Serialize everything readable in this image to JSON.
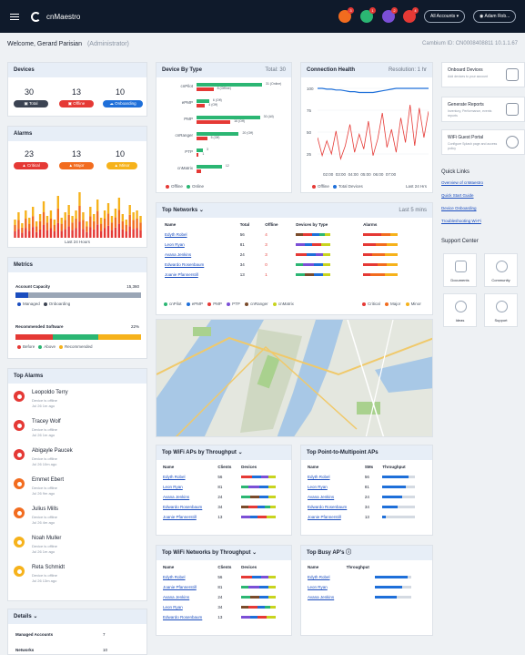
{
  "header": {
    "brand": "cnMaestro",
    "notif_counts": [
      "3",
      "1",
      "2",
      "4"
    ],
    "account_label": "All Accounts",
    "user_label": "Adam Rob..."
  },
  "welcome": {
    "text": "Welcome,  Gerard Parisian",
    "role": "(Administrator)"
  },
  "serial": {
    "text": "Cambium ID:  CN0008408811   10.1.1.67"
  },
  "devices": {
    "title": "Devices",
    "items": [
      {
        "count": "30",
        "label": "Total",
        "color": "#3b4352"
      },
      {
        "count": "13",
        "label": "Offline",
        "color": "#e53935"
      },
      {
        "count": "10",
        "label": "Onboarding",
        "color": "#1e6fd9"
      }
    ]
  },
  "alarms": {
    "title": "Alarms",
    "items": [
      {
        "count": "23",
        "label": "Critical",
        "color": "#e53935"
      },
      {
        "count": "13",
        "label": "Major",
        "color": "#f26c1f"
      },
      {
        "count": "10",
        "label": "Minor",
        "color": "#f6b21b"
      }
    ],
    "axis_label": "Last 24 Hours"
  },
  "metrics": {
    "title": "Metrics",
    "capacity_label": "Account Capacity",
    "capacity_value": "15,360",
    "capacity_fill": 0.1,
    "capacity_legend": [
      "Managed",
      "Onboarding"
    ],
    "software_label": "Recommended Software",
    "software_value": "22%",
    "software_fill": 0.22,
    "software_legend": [
      "Before",
      "Above",
      "Recommended"
    ]
  },
  "top_alarms": {
    "title": "Top Alarms",
    "items": [
      {
        "name": "Leopoldo Terry",
        "status": "Device is offline",
        "time": "Jul 26 1m ago",
        "color": "#e53935"
      },
      {
        "name": "Tracey Wolf",
        "status": "Device is offline",
        "time": "Jul 26 1m ago",
        "color": "#e53935"
      },
      {
        "name": "Abigayle Paucek",
        "status": "Device is offline",
        "time": "Jul 26 10m ago",
        "color": "#e53935"
      },
      {
        "name": "Emmet Ebert",
        "status": "Device is offline",
        "time": "Jul 26 9m ago",
        "color": "#f26c1f"
      },
      {
        "name": "Julius Mills",
        "status": "Device is offline",
        "time": "Jul 26 4m ago",
        "color": "#f26c1f"
      },
      {
        "name": "Noah Muller",
        "status": "Device is offline",
        "time": "Jul 26 1m ago",
        "color": "#f6b21b"
      },
      {
        "name": "Reta Schmidt",
        "status": "Device is offline",
        "time": "Jul 26 13m ago",
        "color": "#f6b21b"
      }
    ]
  },
  "details": {
    "title": "Details",
    "rows": [
      {
        "label": "Managed Accounts",
        "value": "7"
      },
      {
        "label": "Networks",
        "value": "10"
      }
    ]
  },
  "device_by_type": {
    "title": "Device By Type",
    "total": "Total: 30",
    "rows": [
      {
        "name": "cnPilot",
        "online": 31,
        "offline": 8,
        "online_label": "31 (Online)",
        "offline_label": "8 (Offline)"
      },
      {
        "name": "ePMP",
        "online": 6,
        "offline": 4,
        "online_label": "6 (Off)",
        "offline_label": "4 (Off)"
      },
      {
        "name": "PMP",
        "online": 30,
        "offline": 16,
        "online_label": "30 (All)",
        "offline_label": "16 (Off)"
      },
      {
        "name": "cnRanger",
        "online": 20,
        "offline": 5,
        "online_label": "20 (Off)",
        "offline_label": "5 (Off)"
      },
      {
        "name": "PTP",
        "online": 3,
        "offline": 1,
        "online_label": "3",
        "offline_label": "1"
      },
      {
        "name": "cnMatrix",
        "online": 12,
        "offline": 2,
        "online_label": "12",
        "offline_label": ""
      }
    ],
    "legend": [
      "Offline",
      "Online"
    ]
  },
  "connection_health": {
    "title": "Connection Health",
    "resolution": "Resolution: 1 hr",
    "y_ticks": [
      "100",
      "75",
      "50",
      "25"
    ],
    "x_ticks": [
      "02:00",
      "03:00",
      "04:00",
      "05:00",
      "06:00",
      "07:00"
    ],
    "x_end": "Last 24 Hrs",
    "legend": [
      "Offline",
      "Total Devices"
    ]
  },
  "top_networks": {
    "title": "Top Networks",
    "period": "Last 5 mins",
    "headers": [
      "Name",
      "Total",
      "Offline",
      "Devices by Type",
      "Alarms"
    ],
    "rows": [
      {
        "name": "Edyth Robel",
        "total": "56",
        "offline": "4"
      },
      {
        "name": "Leon Ryan",
        "total": "81",
        "offline": "3"
      },
      {
        "name": "Avana Jenkins",
        "total": "24",
        "offline": "3"
      },
      {
        "name": "Edwardo Rosenbaum",
        "total": "34",
        "offline": "0"
      },
      {
        "name": "Joanie Pfannerstill",
        "total": "13",
        "offline": "1"
      }
    ],
    "legend_types": [
      "cnPilot",
      "ePMP",
      "PMP",
      "PTP",
      "cnRanger",
      "cnMatrix"
    ],
    "legend_alarms": [
      "Critical",
      "Major",
      "Minor"
    ]
  },
  "wifi_aps": {
    "title": "Top WiFi APs by Throughput",
    "headers": [
      "Name",
      "Clients",
      "Devices"
    ],
    "rows": [
      {
        "name": "Edyth Robel",
        "clients": "56"
      },
      {
        "name": "Leon Ryan",
        "clients": "81"
      },
      {
        "name": "Avana Jenkins",
        "clients": "24"
      },
      {
        "name": "Edwardo Rosenbaum",
        "clients": "34"
      },
      {
        "name": "Joanie Pfannerstill",
        "clients": "13"
      }
    ]
  },
  "ptmp_aps": {
    "title": "Top Point-to-Multipoint APs",
    "headers": [
      "Name",
      "SMs",
      "Throughput"
    ],
    "rows": [
      {
        "name": "Edyth Robel",
        "sms": "56",
        "fill": 0.8
      },
      {
        "name": "Leon Ryan",
        "sms": "81",
        "fill": 0.7
      },
      {
        "name": "Avana Jenkins",
        "sms": "24",
        "fill": 0.6
      },
      {
        "name": "Edwardo Rosenbaum",
        "sms": "34",
        "fill": 0.45
      },
      {
        "name": "Joanie Pfannerstill",
        "sms": "13",
        "fill": 0.1
      }
    ]
  },
  "wifi_networks": {
    "title": "Top WiFi Networks by Throughput",
    "headers": [
      "Name",
      "Clients",
      "Devices"
    ],
    "rows": [
      {
        "name": "Edyth Robel",
        "clients": "56"
      },
      {
        "name": "Joanie Pfannerstill",
        "clients": "81"
      },
      {
        "name": "Avana Jenkins",
        "clients": "24"
      },
      {
        "name": "Leon Ryan",
        "clients": "34"
      },
      {
        "name": "Edwardo Rosenbaum",
        "clients": "13"
      }
    ]
  },
  "busy_aps": {
    "title": "Top Busy AP's",
    "headers": [
      "Name",
      "Throughput"
    ],
    "rows": [
      {
        "name": "Edyth Robel",
        "fill": 0.9
      },
      {
        "name": "Leon Ryan",
        "fill": 0.75
      },
      {
        "name": "Avana Jenkins",
        "fill": 0.6
      }
    ]
  },
  "sidebar": {
    "actions": [
      {
        "title": "Onboard Devices",
        "desc": "Add devices to your account"
      },
      {
        "title": "Generate Reports",
        "desc": "Inventory, Performance, events reports"
      },
      {
        "title": "WiFi Guest Portal",
        "desc": "Configure Splash page and access policy"
      }
    ],
    "quick_links_title": "Quick Links",
    "quick_links": [
      "Overview of cnMaestro",
      "Quick Start Guide",
      "Device Onboarding",
      "Troubleshooting Wi-Fi"
    ],
    "support_title": "Support Center",
    "support_items": [
      "Documents",
      "Community",
      "Ideas",
      "Support"
    ]
  }
}
